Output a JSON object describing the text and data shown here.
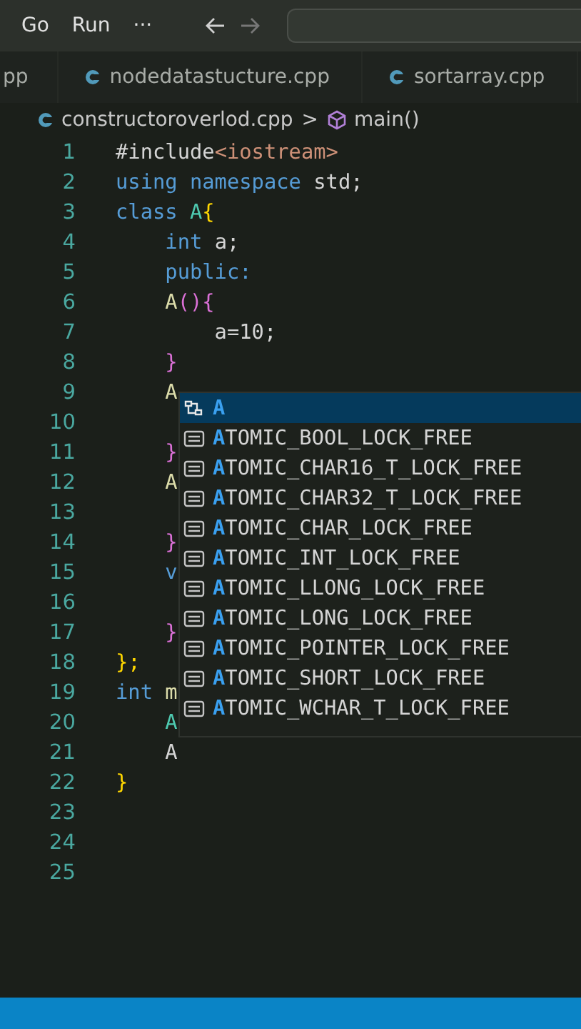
{
  "menu": [
    "Go",
    "Run",
    "···"
  ],
  "tabs": [
    {
      "label": "pp",
      "icon": false,
      "selected": false
    },
    {
      "label": "nodedatastucture.cpp",
      "icon": true,
      "selected": false
    },
    {
      "label": "sortarray.cpp",
      "icon": true,
      "selected": false
    }
  ],
  "breadcrumb": {
    "file": "constructoroverlod.cpp",
    "separator": ">",
    "symbol": "main()"
  },
  "lines": [
    {
      "number": "1",
      "tokens": [
        {
          "text": "#include",
          "kind": "plain"
        },
        {
          "text": "<iostream>",
          "kind": "string"
        }
      ]
    },
    {
      "number": "2",
      "tokens": [
        {
          "text": "using namespace",
          "kind": "keyword"
        },
        {
          "text": " std;",
          "kind": "plain"
        }
      ]
    },
    {
      "number": "3",
      "tokens": [
        {
          "text": "class",
          "kind": "keyword"
        },
        {
          "text": " A",
          "kind": "type"
        },
        {
          "text": "{",
          "kind": "brace"
        }
      ]
    },
    {
      "number": "4",
      "tokens": [
        {
          "text": "    int",
          "kind": "keyword"
        },
        {
          "text": " a;",
          "kind": "plain"
        }
      ]
    },
    {
      "number": "5",
      "tokens": [
        {
          "text": "    public:",
          "kind": "keyword"
        }
      ]
    },
    {
      "number": "6",
      "tokens": [
        {
          "text": "    A",
          "kind": "func"
        },
        {
          "text": "(){",
          "kind": "paren"
        }
      ]
    },
    {
      "number": "7",
      "tokens": [
        {
          "text": "        a=10;",
          "kind": "plain"
        }
      ]
    },
    {
      "number": "8",
      "tokens": [
        {
          "text": "    }",
          "kind": "paren"
        }
      ]
    },
    {
      "number": "9",
      "tokens": [
        {
          "text": "    A",
          "kind": "func"
        }
      ]
    },
    {
      "number": "10"
    },
    {
      "number": "11",
      "tokens": [
        {
          "text": "    }",
          "kind": "paren"
        }
      ]
    },
    {
      "number": "12",
      "tokens": [
        {
          "text": "    A",
          "kind": "func"
        }
      ]
    },
    {
      "number": "13"
    },
    {
      "number": "14",
      "tokens": [
        {
          "text": "    }",
          "kind": "paren"
        }
      ]
    },
    {
      "number": "15",
      "tokens": [
        {
          "text": "    v",
          "kind": "keyword"
        }
      ]
    },
    {
      "number": "16"
    },
    {
      "number": "17",
      "tokens": [
        {
          "text": "    }",
          "kind": "paren"
        }
      ]
    },
    {
      "number": "18",
      "tokens": [
        {
          "text": "};",
          "kind": "brace"
        }
      ]
    },
    {
      "number": "19",
      "tokens": [
        {
          "text": "int",
          "kind": "keyword"
        },
        {
          "text": " m",
          "kind": "func"
        }
      ]
    },
    {
      "number": "20",
      "tokens": [
        {
          "text": "    A",
          "kind": "type"
        }
      ]
    },
    {
      "number": "21",
      "tokens": [
        {
          "text": "    A",
          "kind": "plain"
        }
      ]
    },
    {
      "number": "22",
      "tokens": [
        {
          "text": "}",
          "kind": "brace"
        }
      ]
    },
    {
      "number": "23"
    },
    {
      "number": "24"
    },
    {
      "number": "25"
    }
  ],
  "suggestions": [
    {
      "label": "A",
      "kind": "class",
      "selected": true
    },
    {
      "label": "ATOMIC_BOOL_LOCK_FREE",
      "kind": "constant",
      "selected": false
    },
    {
      "label": "ATOMIC_CHAR16_T_LOCK_FREE",
      "kind": "constant",
      "selected": false
    },
    {
      "label": "ATOMIC_CHAR32_T_LOCK_FREE",
      "kind": "constant",
      "selected": false
    },
    {
      "label": "ATOMIC_CHAR_LOCK_FREE",
      "kind": "constant",
      "selected": false
    },
    {
      "label": "ATOMIC_INT_LOCK_FREE",
      "kind": "constant",
      "selected": false
    },
    {
      "label": "ATOMIC_LLONG_LOCK_FREE",
      "kind": "constant",
      "selected": false
    },
    {
      "label": "ATOMIC_LONG_LOCK_FREE",
      "kind": "constant",
      "selected": false
    },
    {
      "label": "ATOMIC_POINTER_LOCK_FREE",
      "kind": "constant",
      "selected": false
    },
    {
      "label": "ATOMIC_SHORT_LOCK_FREE",
      "kind": "constant",
      "selected": false
    },
    {
      "label": "ATOMIC_WCHAR_T_LOCK_FREE",
      "kind": "constant",
      "selected": false
    }
  ]
}
